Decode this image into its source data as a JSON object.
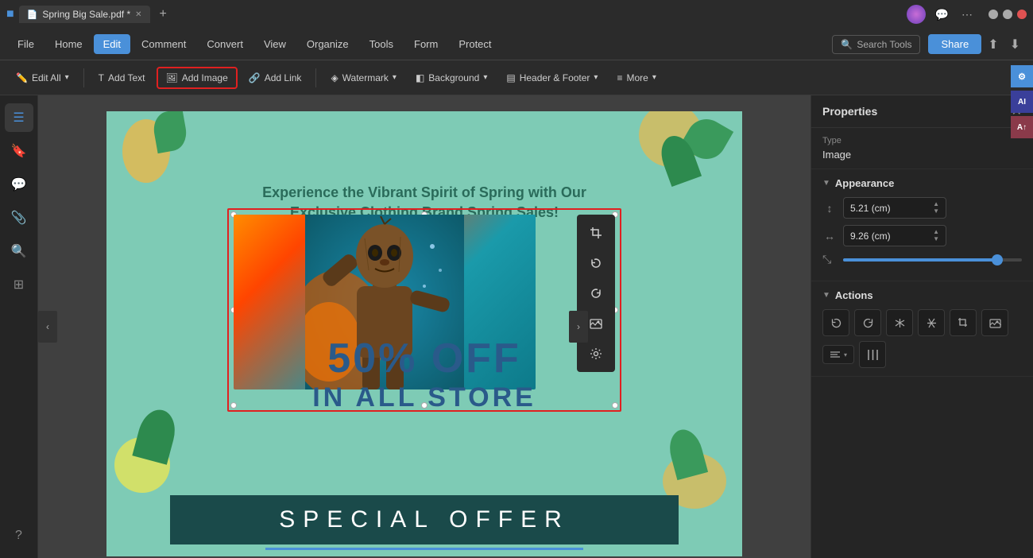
{
  "titleBar": {
    "appIcon": "■",
    "tabLabel": "Spring Big Sale.pdf *",
    "tabClose": "✕",
    "addTab": "+",
    "rightIcons": [
      "💬",
      "⋯",
      "─",
      "□",
      "✕"
    ]
  },
  "menuBar": {
    "items": [
      "File",
      "Home",
      "Edit",
      "Comment",
      "Convert",
      "View",
      "Organize",
      "Tools",
      "Form",
      "Protect"
    ],
    "activeItem": "Edit",
    "searchTools": "Search Tools",
    "share": "Share"
  },
  "toolbar": {
    "editAll": "Edit All",
    "addText": "Add Text",
    "addImage": "Add Image",
    "addLink": "Add Link",
    "watermark": "Watermark",
    "background": "Background",
    "headerFooter": "Header & Footer",
    "more": "More"
  },
  "leftSidebar": {
    "icons": [
      "☰",
      "🔖",
      "💬",
      "📎",
      "🔍",
      "⊞",
      "?"
    ]
  },
  "canvas": {
    "headline": "Experience the Vibrant Spirit of Spring with Our Exclusive Clothing Brand Spring Sales!",
    "salePercent": "50% OFF",
    "saleStore": "IN ALL STORE",
    "specialOffer": "SPECIAL OFFER"
  },
  "floatToolbar": {
    "buttons": [
      "⊠",
      "↺",
      "↻",
      "🖼",
      "⚙"
    ]
  },
  "rightPanel": {
    "title": "Properties",
    "closeIcon": "✕",
    "typeLabel": "Type",
    "typeValue": "Image",
    "appearance": {
      "label": "Appearance",
      "heightLabel": "Height",
      "heightValue": "5.21 (cm)",
      "widthLabel": "Width",
      "widthValue": "9.26 (cm)",
      "sliderValue": 85
    },
    "actions": {
      "label": "Actions",
      "buttons": [
        "↺",
        "↻",
        "⟲",
        "⟳",
        "⊟",
        "🖼"
      ],
      "alignIcon": "≡",
      "distributeIcon": "|||"
    }
  },
  "panelIconsRight": {
    "icons": [
      "⚙",
      "AI",
      "A↑"
    ]
  }
}
